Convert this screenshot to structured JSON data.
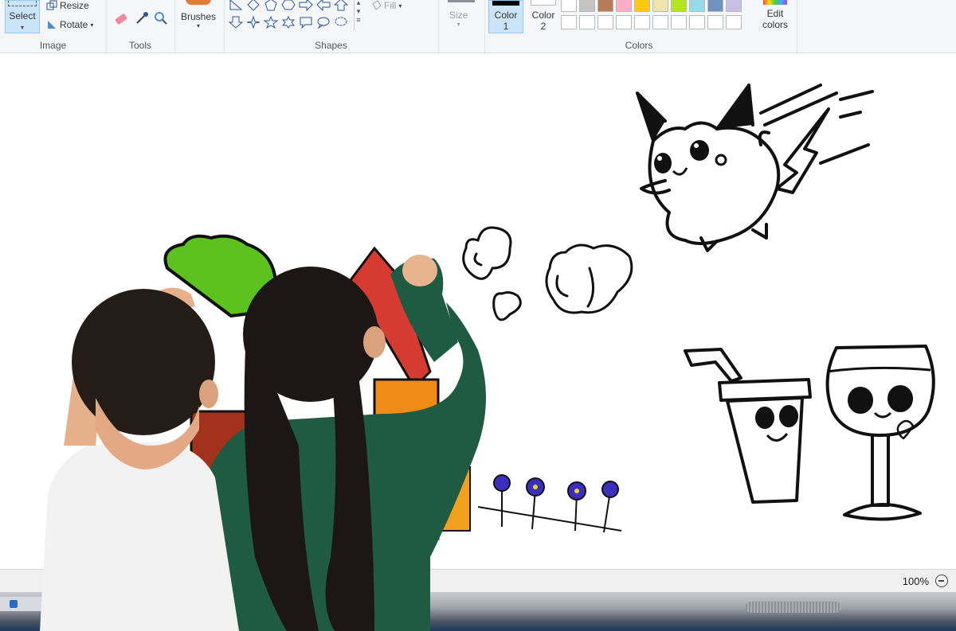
{
  "ribbon": {
    "image_group": {
      "label": "Image",
      "select_label": "Select",
      "resize_label": "Resize",
      "rotate_label": "Rotate"
    },
    "tools_group": {
      "label": "Tools"
    },
    "brushes_label": "Brushes",
    "shapes_group": {
      "label": "Shapes",
      "fill_label": "Fill"
    },
    "size_label": "Size",
    "colors_group": {
      "label": "Colors",
      "color1_label": "Color",
      "color1_num": "1",
      "color2_label": "Color",
      "color2_num": "2",
      "edit_colors_line1": "Edit",
      "edit_colors_line2": "colors",
      "color1_value": "#000000",
      "color2_value": "#ffffff",
      "palette_row1": [
        "#ffffff",
        "#c3c3c3",
        "#b97a57",
        "#ffaec9",
        "#ffc90e",
        "#efe4b0",
        "#b5e61d",
        "#99d9ea",
        "#7092be",
        "#c8bfe7"
      ],
      "palette_row2": [
        "#ffffff",
        "#ffffff",
        "#ffffff",
        "#ffffff",
        "#ffffff",
        "#ffffff",
        "#ffffff",
        "#ffffff",
        "#ffffff",
        "#ffffff"
      ]
    }
  },
  "status": {
    "zoom": "100%"
  }
}
